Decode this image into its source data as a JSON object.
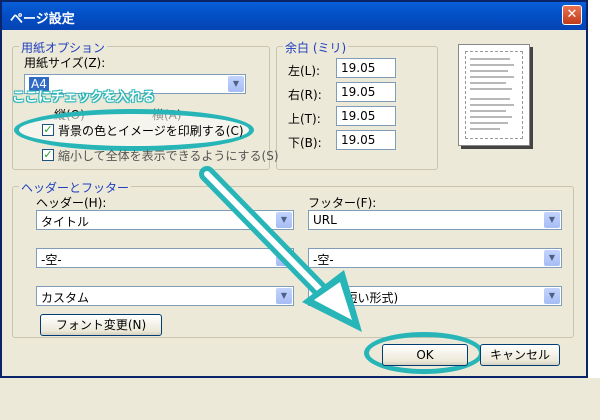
{
  "dialog": {
    "title": "ページ設定",
    "close_glyph": "✕"
  },
  "callout": {
    "text": "ここにチェックを入れる"
  },
  "paper": {
    "group_title": "用紙オプション",
    "size_label": "用紙サイズ(Z):",
    "size_value": "A4",
    "orientation_portrait": "縦(O)",
    "orientation_landscape": "横(A)",
    "print_bg_label": "背景の色とイメージを印刷する(C)",
    "shrink_label": "縮小して全体を表示できるようにする(S)"
  },
  "margins": {
    "group_title": "余白 (ミリ)",
    "left_label": "左(L):",
    "left_value": "19.05",
    "right_label": "右(R):",
    "right_value": "19.05",
    "top_label": "上(T):",
    "top_value": "19.05",
    "bottom_label": "下(B):",
    "bottom_value": "19.05"
  },
  "headerfooter": {
    "group_title": "ヘッダーとフッター",
    "header_label": "ヘッダー(H):",
    "footer_label": "フッター(F):",
    "header_rows": [
      "タイトル",
      "-空-",
      "カスタム"
    ],
    "footer_rows": [
      "URL",
      "-空-",
      "日付 (短い形式)"
    ],
    "font_button": "フォント変更(N)"
  },
  "buttons": {
    "ok": "OK",
    "cancel": "キャンセル"
  },
  "colors": {
    "accent": "#27b5b8",
    "titlebar": "#0350c8",
    "dialog_bg": "#ece9d8"
  }
}
